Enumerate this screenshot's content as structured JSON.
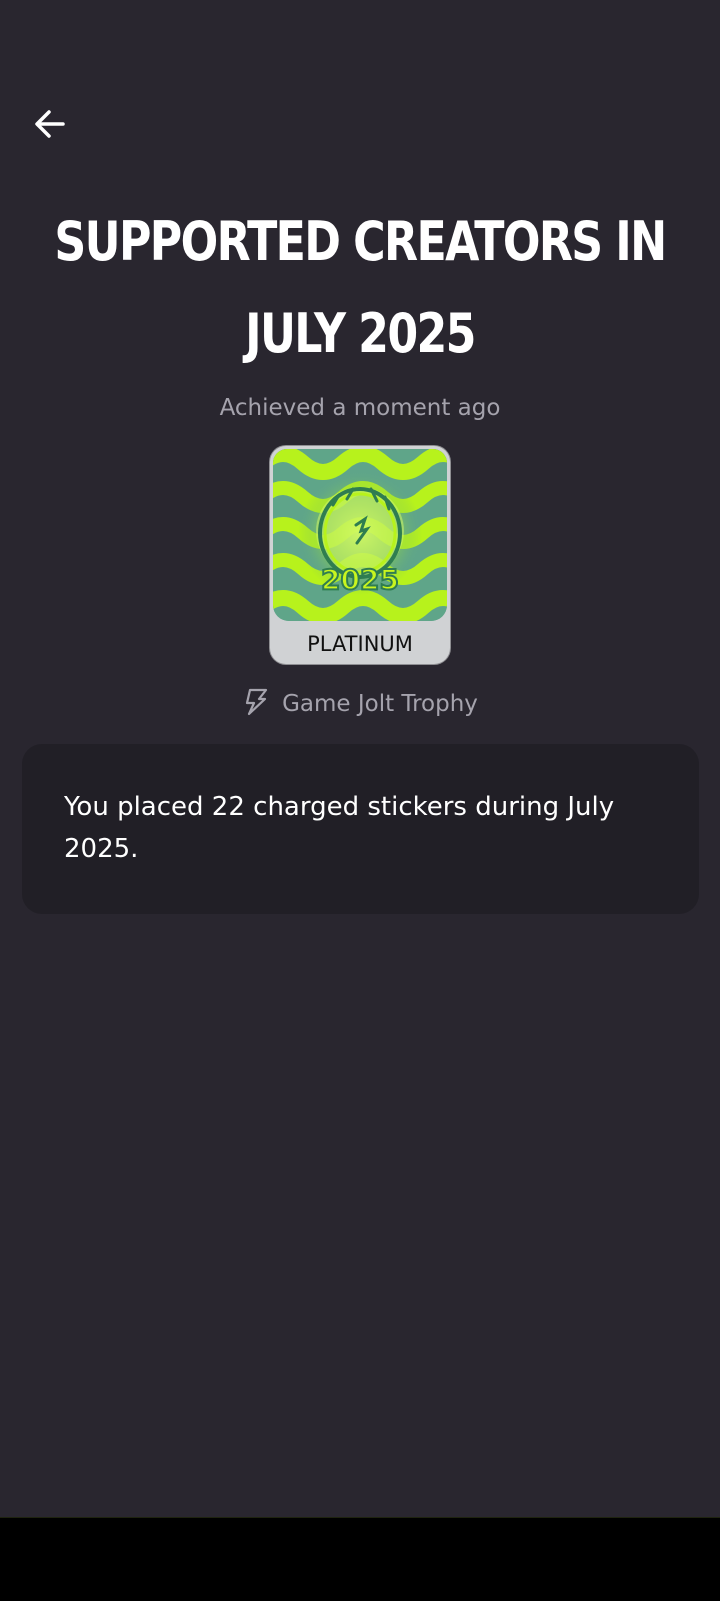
{
  "header": {
    "back_icon": "arrow-left-icon"
  },
  "trophy": {
    "title": "SUPPORTED CREATORS IN JULY 2025",
    "achieved": "Achieved a moment ago",
    "tier": "PLATINUM",
    "badge_year": "2025",
    "source_icon": "game-jolt-bolt-icon",
    "source": "Game Jolt Trophy",
    "description": "You placed 22 charged stickers during July 2025."
  },
  "colors": {
    "background": "#29262f",
    "card": "#211f26",
    "muted_text": "#a5a3ad",
    "tier_plate": "#d0d2d4",
    "art_green": "#b7f21c",
    "art_teal": "#5fa589"
  }
}
